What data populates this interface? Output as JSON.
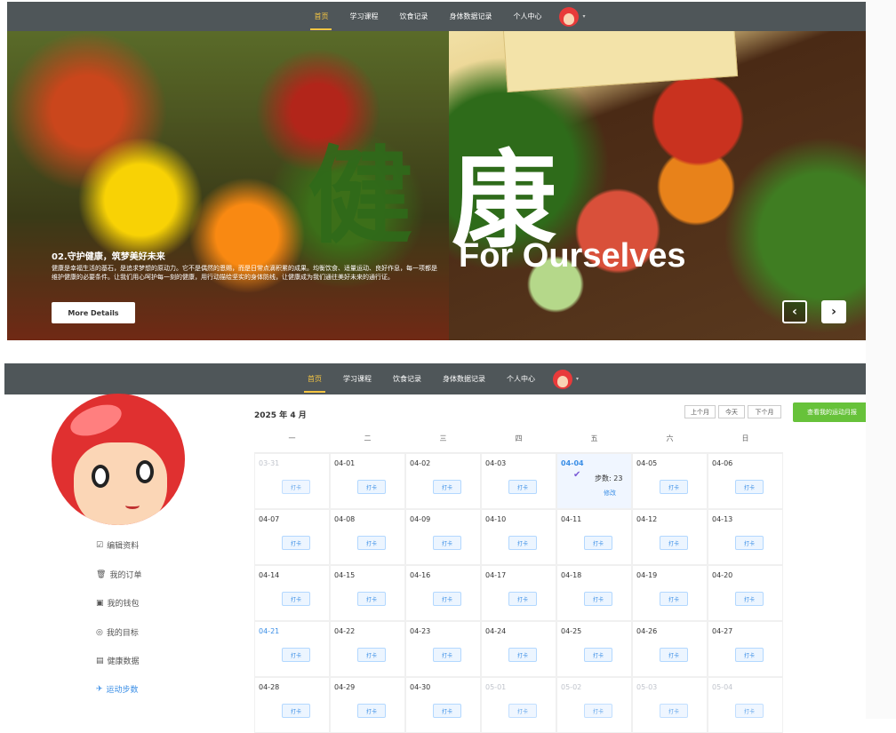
{
  "nav": {
    "items": [
      "首页",
      "学习课程",
      "饮食记录",
      "身体数据记录",
      "个人中心"
    ],
    "active_index": 0,
    "avatar_icon": "avatar-icon"
  },
  "banner": {
    "big_char_1": "健",
    "big_char_2": "康",
    "subtitle": "For Ourselves",
    "title": "02.守护健康，筑梦美好未来",
    "desc": "健康是幸福生活的基石，是追求梦想的原动力。它不是偶然的恩赐，而是日常点滴积累的成果。均衡饮食、适量运动、良好作息，每一项都是维护健康的必要条件。让我们用心呵护每一刻的健康，用行动描绘坚实的身体防线，让健康成为我们通往美好未来的通行证。",
    "button": "More Details",
    "prev_icon": "chevron-left-icon",
    "next_icon": "chevron-right-icon"
  },
  "sidebar": {
    "items": [
      {
        "icon": "☑",
        "label": "编辑资料"
      },
      {
        "icon": "🗑",
        "label": "我的订单"
      },
      {
        "icon": "▣",
        "label": "我的钱包"
      },
      {
        "icon": "◎",
        "label": "我的目标"
      },
      {
        "icon": "▤",
        "label": "健康数据"
      },
      {
        "icon": "✈",
        "label": "运动步数"
      }
    ],
    "active_index": 5
  },
  "calendar": {
    "title": "2025 年 4 月",
    "prev": "上个月",
    "today": "今天",
    "next": "下个月",
    "report": "查看我的运动月报",
    "weekdays": [
      "一",
      "二",
      "三",
      "四",
      "五",
      "六",
      "日"
    ],
    "checkin_label": "打卡",
    "steps_label": "步数: 23",
    "edit_label": "修改",
    "days": [
      "03-31",
      "04-01",
      "04-02",
      "04-03",
      "04-04",
      "04-05",
      "04-06",
      "04-07",
      "04-08",
      "04-09",
      "04-10",
      "04-11",
      "04-12",
      "04-13",
      "04-14",
      "04-15",
      "04-16",
      "04-17",
      "04-18",
      "04-19",
      "04-20",
      "04-21",
      "04-22",
      "04-23",
      "04-24",
      "04-25",
      "04-26",
      "04-27",
      "04-28",
      "04-29",
      "04-30",
      "05-01",
      "05-02",
      "05-03",
      "05-04"
    ],
    "other_month": [
      "03-31",
      "05-01",
      "05-02",
      "05-03",
      "05-04"
    ],
    "highlighted": [
      "04-21"
    ],
    "today_date": "04-04"
  }
}
